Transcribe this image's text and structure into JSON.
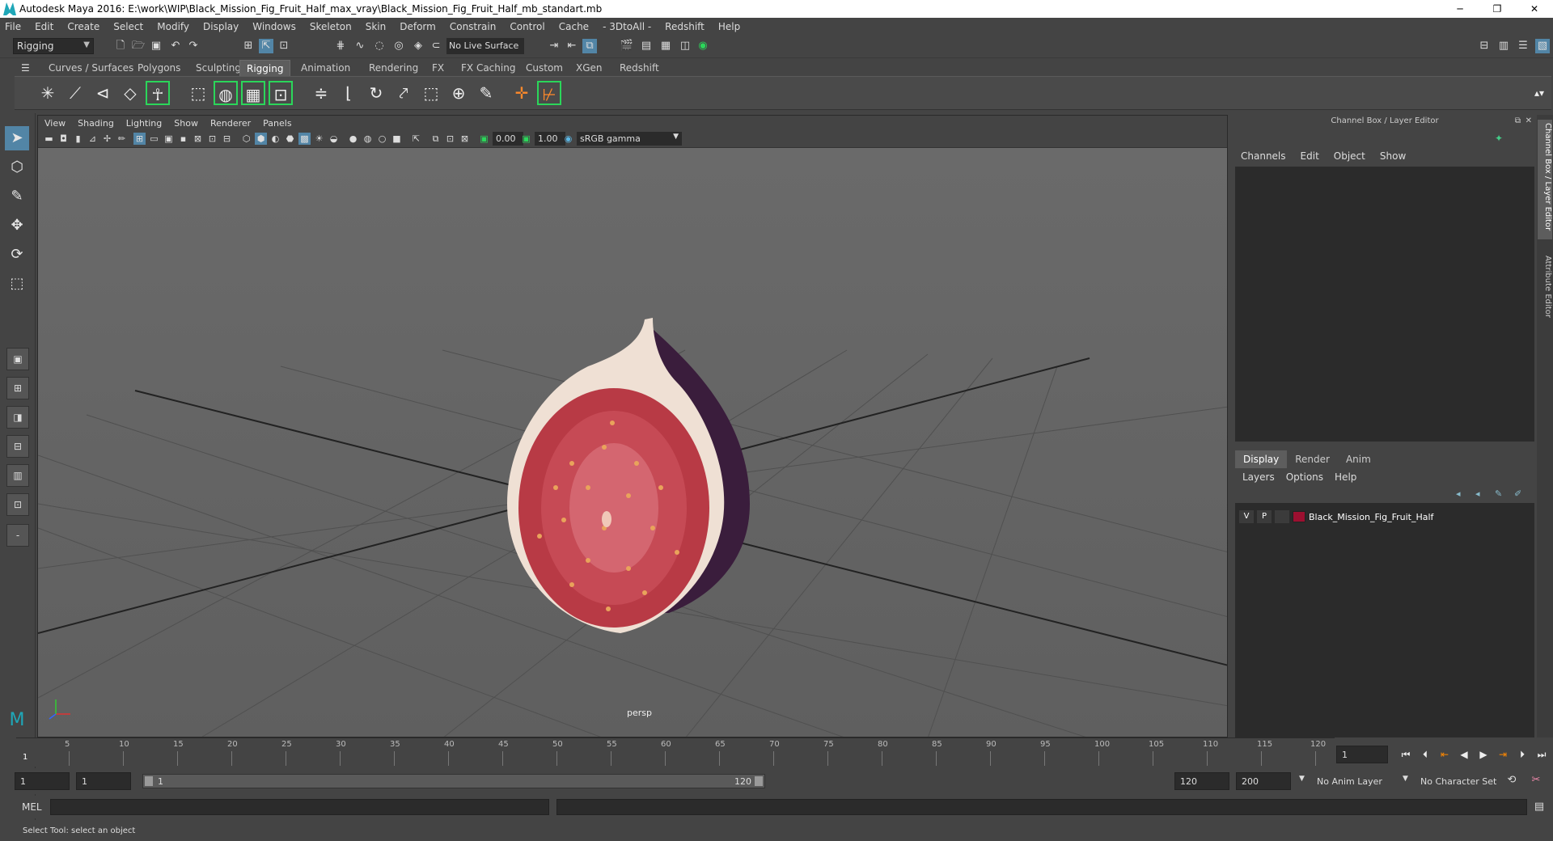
{
  "window": {
    "title": "Autodesk Maya 2016: E:\\work\\WIP\\Black_Mission_Fig_Fruit_Half_max_vray\\Black_Mission_Fig_Fruit_Half_mb_standart.mb",
    "minimize": "─",
    "restore": "❐",
    "close": "✕"
  },
  "menubar": [
    "File",
    "Edit",
    "Create",
    "Select",
    "Modify",
    "Display",
    "Windows",
    "Skeleton",
    "Skin",
    "Deform",
    "Constrain",
    "Control",
    "Cache",
    "- 3DtoAll -",
    "Redshift",
    "Help"
  ],
  "statusline": {
    "mode": "Rigging",
    "live_surface": "No Live Surface"
  },
  "shelf_tabs": [
    "Curves / Surfaces",
    "Polygons",
    "Sculpting",
    "Rigging",
    "Animation",
    "Rendering",
    "FX",
    "FX Caching",
    "Custom",
    "XGen",
    "Redshift"
  ],
  "shelf_active": "Rigging",
  "viewport": {
    "menu": [
      "View",
      "Shading",
      "Lighting",
      "Show",
      "Renderer",
      "Panels"
    ],
    "exposure": "0.00",
    "gamma": "1.00",
    "color_space": "sRGB gamma",
    "camera_label": "persp"
  },
  "channel_box": {
    "title": "Channel Box / Layer Editor",
    "menu": [
      "Channels",
      "Edit",
      "Object",
      "Show"
    ]
  },
  "layer_editor": {
    "tabs": [
      "Display",
      "Render",
      "Anim"
    ],
    "active_tab": "Display",
    "menu": [
      "Layers",
      "Options",
      "Help"
    ],
    "layers": [
      {
        "v": "V",
        "p": "P",
        "name": "Black_Mission_Fig_Fruit_Half",
        "color": "#9c1030"
      }
    ]
  },
  "side_tabs": [
    "Channel Box / Layer Editor",
    "Attribute Editor"
  ],
  "timeline": {
    "ticks": [
      "5",
      "10",
      "15",
      "20",
      "25",
      "30",
      "35",
      "40",
      "45",
      "50",
      "55",
      "60",
      "65",
      "70",
      "75",
      "80",
      "85",
      "90",
      "95",
      "100",
      "105",
      "110",
      "115",
      "120"
    ],
    "start_marker": "1",
    "current_frame": "1"
  },
  "range": {
    "start": "1",
    "playback_start": "1",
    "slider_start": "1",
    "slider_end": "120",
    "playback_end": "120",
    "end": "200",
    "anim_layer": "No Anim Layer",
    "character_set": "No Character Set"
  },
  "command_line": {
    "label": "MEL"
  },
  "help_line": "Select Tool: select an object"
}
